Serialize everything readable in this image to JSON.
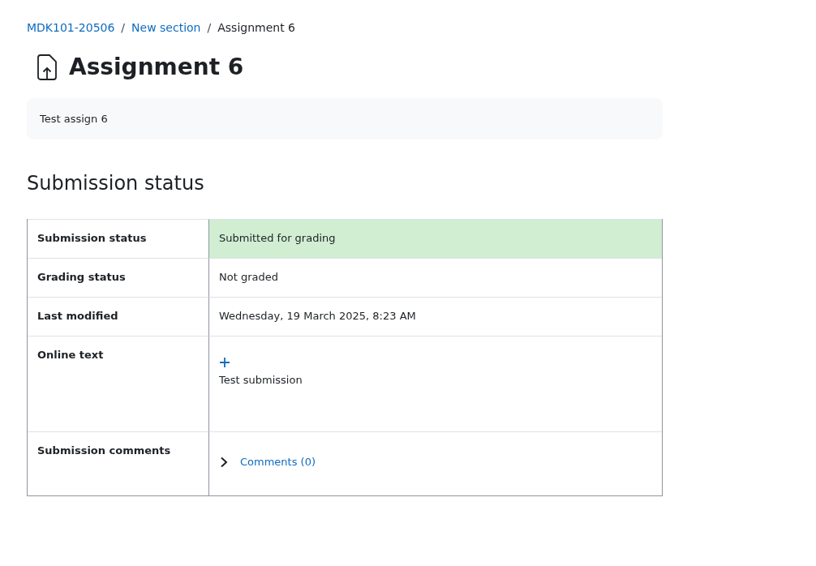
{
  "breadcrumb_separator": "/",
  "breadcrumb": [
    {
      "label": "MDK101-20506",
      "kind": "link"
    },
    {
      "label": "New section",
      "kind": "link"
    },
    {
      "label": "Assignment 6",
      "kind": "current"
    }
  ],
  "title": "Assignment 6",
  "description": "Test assign 6",
  "section_heading": "Submission status",
  "rows": [
    {
      "kind": "text",
      "label": "Submission status",
      "value": "Submitted for grading",
      "highlight": true
    },
    {
      "kind": "text",
      "label": "Grading status",
      "value": "Not graded",
      "highlight": false
    },
    {
      "kind": "text",
      "label": "Last modified",
      "value": "Wednesday, 19 March 2025, 8:23 AM",
      "highlight": false
    },
    {
      "kind": "online_text",
      "label": "Online text",
      "value": "Test submission",
      "highlight": false
    },
    {
      "kind": "comments",
      "label": "Submission comments",
      "value": "Comments (0)",
      "expanded": false,
      "highlight": false
    }
  ]
}
